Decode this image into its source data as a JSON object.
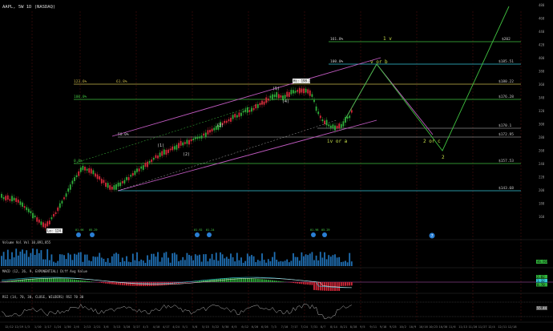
{
  "header": {
    "symbol_line": "AAPL, 5W 1D (NASDAQ)",
    "price_scale_labels": [
      "480",
      "460",
      "440",
      "420",
      "400",
      "380",
      "360",
      "340",
      "320",
      "300",
      "280",
      "260",
      "240",
      "220",
      "200",
      "180",
      "160"
    ],
    "corner_value": "0.6"
  },
  "fib_levels": [
    {
      "pct": "161.8%",
      "price": "$202"
    },
    {
      "pct": "100.0%",
      "price": "$185.51"
    },
    {
      "pct": "123.6%",
      "price": "$180.22"
    },
    {
      "pct": "100.0%",
      "price": "$176.28"
    },
    {
      "pct": "61.8%",
      "price": "$170.1"
    },
    {
      "pct": "50.0%",
      "price": "$172.95"
    },
    {
      "pct": "0.0%",
      "price": "$157.53"
    },
    {
      "pct": "",
      "price": "$143.68"
    }
  ],
  "annotations": {
    "wave_iv_or_a": "iv or a",
    "wave_v_or_b": "v or b",
    "wave_1_v": "1 v",
    "wave_2_or_c": "2 or c",
    "wave_2": "2",
    "wave_5": "(5)",
    "wave_4": "(4)",
    "wave_3": "(3)",
    "wave_2b": "(2)",
    "wave_1": "(1)",
    "high_label": "Hi: 198.23",
    "low_label": "Lo: 124.17",
    "event_labels": [
      "01.96",
      "05.29",
      "01.92",
      "01.24",
      "01.96",
      "05.29"
    ]
  },
  "x_axis": [
    "12/12",
    "12/19",
    "1/3",
    "1/10",
    "1/17",
    "1/24",
    "1/30",
    "2/6",
    "2/13",
    "2/21",
    "3/6",
    "3/13",
    "3/20",
    "3/27",
    "4/3",
    "4/10",
    "4/17",
    "4/24",
    "5/1",
    "5/8",
    "5/15",
    "5/22",
    "5/30",
    "6/5",
    "6/12",
    "6/20",
    "6/26",
    "7/3",
    "7/10",
    "7/17",
    "7/24",
    "7/31",
    "8/7",
    "8/14",
    "8/21",
    "8/28",
    "9/5",
    "9/11",
    "9/18",
    "9/25",
    "10/2",
    "10/9",
    "10/16",
    "10/23",
    "10/30",
    "11/6",
    "11/13",
    "11/20",
    "11/27",
    "12/4",
    "12/11",
    "12/18"
  ],
  "volume_panel": {
    "label": "Volume  Vol  Vol  10,891,855",
    "value": "46.91M"
  },
  "macd_panel": {
    "label": "MACD (12, 26, 9, EXPONENTIAL)  Diff  Avg  Value",
    "values": [
      "2.02",
      "1.32",
      "0.70"
    ]
  },
  "rsi_panel": {
    "label": "RSI (14, 70, 30, CLOSE, WILDERS)  RSI  70  30",
    "value": "55.44"
  },
  "colors": {
    "background": "#000000",
    "candle_up": "#2fae3a",
    "candle_down": "#d6283a",
    "fib_green": "#3fbf3f",
    "fib_cyan": "#35c7d8",
    "fib_yellow": "#c8b84a",
    "channel_magenta": "#c05ac0",
    "grid_red": "#5a1010"
  },
  "icons": [
    "info-icon"
  ]
}
